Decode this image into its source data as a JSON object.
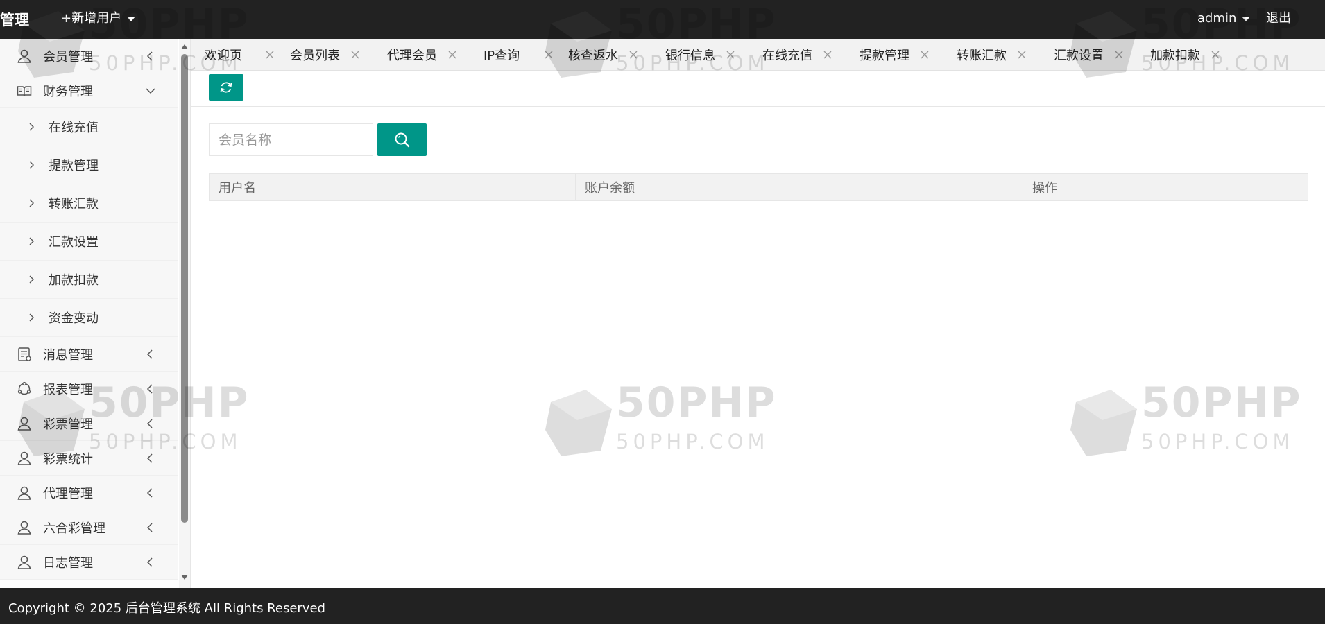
{
  "header": {
    "brand": "管理",
    "add_user": "+新增用户",
    "user": "admin",
    "logout": "退出"
  },
  "sidebar": {
    "items": [
      {
        "label": "会员管理",
        "icon": "user-icon"
      },
      {
        "label": "财务管理",
        "icon": "book-icon",
        "expanded": true,
        "children": [
          {
            "label": "在线充值"
          },
          {
            "label": "提款管理"
          },
          {
            "label": "转账汇款"
          },
          {
            "label": "汇款设置"
          },
          {
            "label": "加款扣款"
          },
          {
            "label": "资金变动"
          }
        ]
      },
      {
        "label": "消息管理",
        "icon": "message-icon"
      },
      {
        "label": "报表管理",
        "icon": "chart-icon"
      },
      {
        "label": "彩票管理",
        "icon": "user-icon"
      },
      {
        "label": "彩票统计",
        "icon": "user-icon"
      },
      {
        "label": "代理管理",
        "icon": "user-icon"
      },
      {
        "label": "六合彩管理",
        "icon": "user-icon"
      },
      {
        "label": "日志管理",
        "icon": "user-icon"
      }
    ]
  },
  "tabs": [
    {
      "label": "欢迎页"
    },
    {
      "label": "会员列表"
    },
    {
      "label": "代理会员"
    },
    {
      "label": "IP查询"
    },
    {
      "label": "核查返水"
    },
    {
      "label": "银行信息"
    },
    {
      "label": "在线充值"
    },
    {
      "label": "提款管理"
    },
    {
      "label": "转账汇款"
    },
    {
      "label": "汇款设置"
    },
    {
      "label": "加款扣款"
    }
  ],
  "search": {
    "placeholder": "会员名称",
    "value": ""
  },
  "table": {
    "columns": [
      "用户名",
      "账户余额",
      "操作"
    ],
    "rows": []
  },
  "watermark": {
    "big": "50PHP",
    "small": "50PHP.COM"
  },
  "footer": {
    "text": "Copyright © 2025 后台管理系统 All Rights Reserved"
  },
  "colors": {
    "header_bg": "#222222",
    "accent": "#009688",
    "tab_bar_bg": "#f2f2f2"
  }
}
